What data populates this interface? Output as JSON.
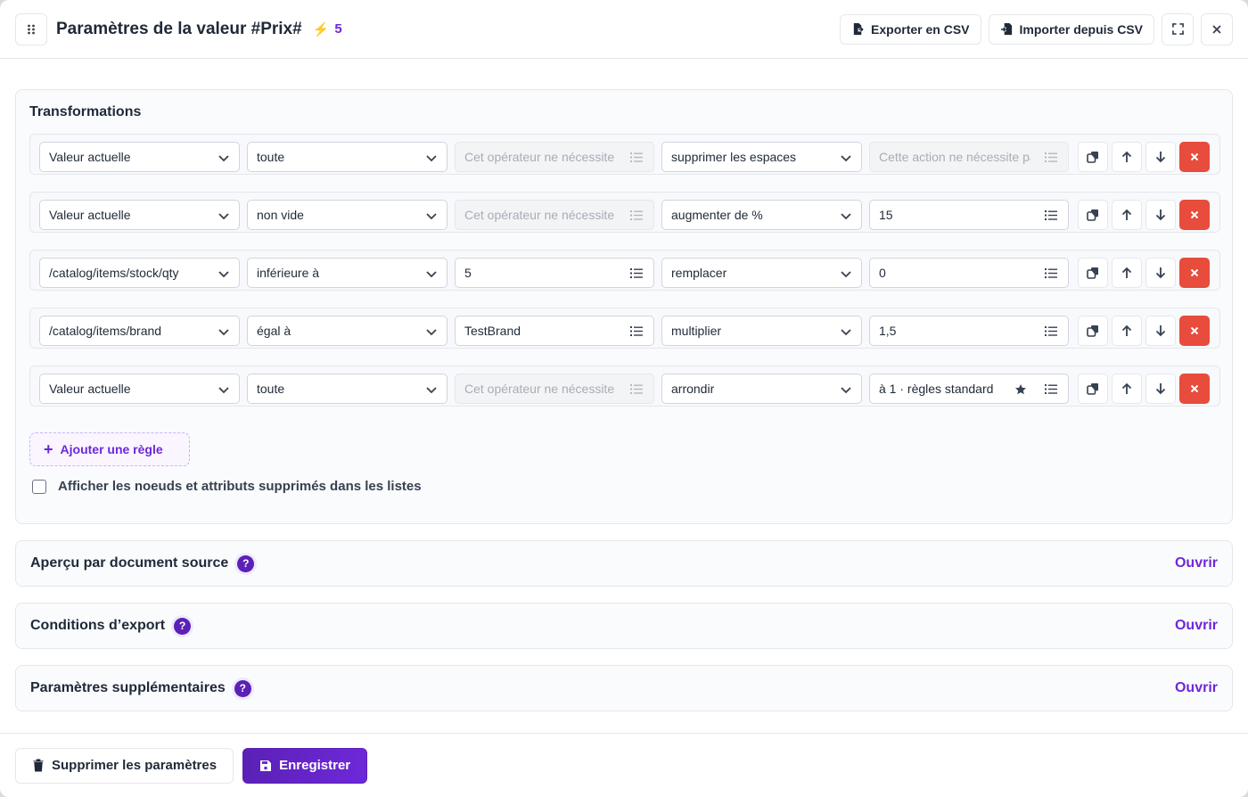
{
  "header": {
    "title": "Paramètres de la valeur #Prix#",
    "bolt": "⚡",
    "count": "5",
    "export_label": "Exporter en CSV",
    "import_label": "Importer depuis CSV"
  },
  "transformations": {
    "title": "Transformations",
    "rules": [
      {
        "source": "Valeur actuelle",
        "operator": "toute",
        "value": "Cet opérateur ne nécessite pas de valeur",
        "value_disabled": true,
        "action": "supprimer les espaces",
        "param": "Cette action ne nécessite pas de paramètre",
        "param_disabled": true,
        "param_star": false
      },
      {
        "source": "Valeur actuelle",
        "operator": "non vide",
        "value": "Cet opérateur ne nécessite pas de valeur",
        "value_disabled": true,
        "action": "augmenter de %",
        "param": "15",
        "param_disabled": false,
        "param_star": false
      },
      {
        "source": "/catalog/items/stock/qty",
        "operator": "inférieure à",
        "value": "5",
        "value_disabled": false,
        "action": "remplacer",
        "param": "0",
        "param_disabled": false,
        "param_star": false
      },
      {
        "source": "/catalog/items/brand",
        "operator": "égal à",
        "value": "TestBrand",
        "value_disabled": false,
        "action": "multiplier",
        "param": "1,5",
        "param_disabled": false,
        "param_star": false
      },
      {
        "source": "Valeur actuelle",
        "operator": "toute",
        "value": "Cet opérateur ne nécessite pas de valeur",
        "value_disabled": true,
        "action": "arrondir",
        "param": "à 1 · règles standard",
        "param_disabled": false,
        "param_star": true
      }
    ],
    "add_rule_label": "Ajouter une règle",
    "show_deleted_label": "Afficher les noeuds et attributs supprimés dans les listes"
  },
  "sections": [
    {
      "title": "Aperçu par document source",
      "help": "?",
      "open_label": "Ouvrir"
    },
    {
      "title": "Conditions d’export",
      "help": "?",
      "open_label": "Ouvrir"
    },
    {
      "title": "Paramètres supplémentaires",
      "help": "?",
      "open_label": "Ouvrir"
    }
  ],
  "footer": {
    "delete_label": "Supprimer les paramètres",
    "save_label": "Enregistrer"
  },
  "colors": {
    "accent": "#6d28d9",
    "danger": "#e74c3c",
    "bolt": "#f5b400"
  }
}
